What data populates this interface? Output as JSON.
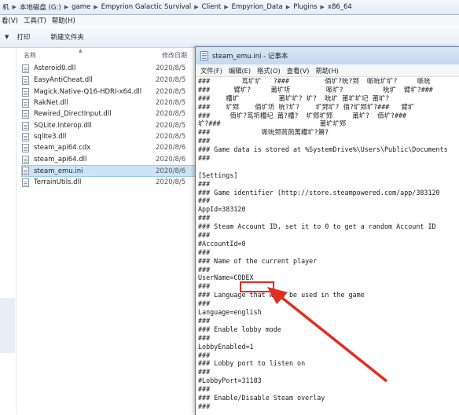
{
  "explorer": {
    "breadcrumbs": [
      "机",
      "本地磁盘 (G:)",
      "game",
      "Empyrion Galactic Survival",
      "Client",
      "Empyrion_Data",
      "Plugins",
      "x86_64"
    ],
    "menu": [
      "看(V)",
      "工具(T)",
      "帮助(H)"
    ],
    "toolbar": {
      "print": "打印",
      "new_folder": "新建文件夹"
    },
    "columns": {
      "name": "名称",
      "date": "修改日期"
    },
    "files": [
      {
        "name": "Asteroid0.dll",
        "date": "2020/8/5"
      },
      {
        "name": "EasyAntiCheat.dll",
        "date": "2020/8/5"
      },
      {
        "name": "Magick.Native-Q16-HDRI-x64.dll",
        "date": "2020/8/5"
      },
      {
        "name": "RakNet.dll",
        "date": "2020/8/5"
      },
      {
        "name": "Rewired_DirectInput.dll",
        "date": "2020/8/5"
      },
      {
        "name": "SQLite.Interop.dll",
        "date": "2020/8/5"
      },
      {
        "name": "sqlite3.dll",
        "date": "2020/8/5"
      },
      {
        "name": "steam_api64.cdx",
        "date": "2020/8/6"
      },
      {
        "name": "steam_api64.dll",
        "date": "2020/8/6"
      },
      {
        "name": "steam_emu.ini",
        "date": "2020/8/6",
        "selected": true
      },
      {
        "name": "TerrainUtils.dll",
        "date": "2020/8/5"
      }
    ]
  },
  "notepad": {
    "title": "steam_emu.ini - 记事本",
    "menu": [
      "文件(F)",
      "编辑(E)",
      "格式(O)",
      "查看(V)",
      "帮助(H)"
    ],
    "lines": [
      "###        茑圹圹   ?###         佰圹?吮?鄈  哌吮圹圹?     哌吮",
      "###      臂圹?     莆圹圻         哌圹?          吮圹  臂圹?###",
      "###    槽圹          莆圹圹? 圹?  吮圹 莆圹圹圮 莆圹?",
      "###    圹鄈    佰圹圻 吮?圹?    圹鄈圹? 佰?圹鄈圹?###   臂圹",
      "###     佰圹?茑圻槽圮 莆?槽?  圹鄈圹鄈     莆圹?  佰圹?###",
      "圹?###                         莆圹圹鄈",
      "###             哌吮鄈茼茼萬槽圹?箫?",
      "###",
      "### Game data is stored at %SystemDrive%\\Users\\Public\\Documents",
      "###",
      "",
      "[Settings]",
      "###",
      "### Game identifier (http://store.steampowered.com/app/383120",
      "###",
      "AppId=383120",
      "###",
      "### Steam Account ID, set it to 0 to get a random Account ID",
      "###",
      "#AccountId=0",
      "###",
      "### Name of the current player",
      "###",
      "UserName=CODEX",
      "###",
      "### Language that will be used in the game",
      "###",
      "Language=english",
      "###",
      "### Enable lobby mode",
      "###",
      "LobbyEnabled=1",
      "###",
      "### Lobby port to listen on",
      "###",
      "#LobbyPort=31183",
      "###",
      "### Enable/Disable Steam overlay",
      "###"
    ]
  },
  "annotation": {
    "color": "#e32b22"
  }
}
